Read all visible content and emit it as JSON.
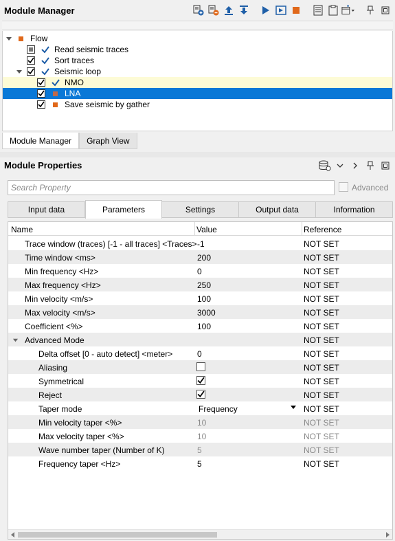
{
  "module_manager": {
    "title": "Module Manager",
    "tree": [
      {
        "label": "Flow",
        "level": 0,
        "expanded": true,
        "marker": "orange-square"
      },
      {
        "label": "Read seismic traces",
        "level": 1,
        "checked": "partial",
        "status": "check"
      },
      {
        "label": "Sort traces",
        "level": 1,
        "checked": true,
        "status": "check"
      },
      {
        "label": "Seismic loop",
        "level": 1,
        "checked": true,
        "status": "check",
        "expanded": true
      },
      {
        "label": "NMO",
        "level": 2,
        "checked": true,
        "status": "check",
        "highlight": true
      },
      {
        "label": "LNA",
        "level": 2,
        "checked": true,
        "status": "orange-square",
        "selected": true
      },
      {
        "label": "Save seismic by gather",
        "level": 2,
        "checked": true,
        "status": "orange-square"
      }
    ],
    "tabs": [
      "Module Manager",
      "Graph View"
    ],
    "active_tab": "Module Manager"
  },
  "module_properties": {
    "title": "Module Properties",
    "search_placeholder": "Search Property",
    "advanced_label": "Advanced",
    "tabs": [
      "Input data",
      "Parameters",
      "Settings",
      "Output data",
      "Information"
    ],
    "active_tab": "Parameters",
    "columns": [
      "Name",
      "Value",
      "Reference"
    ],
    "rows": [
      {
        "name": "Trace window (traces) [-1 - all traces] <Traces>",
        "value": "-1",
        "ref": "NOT SET"
      },
      {
        "name": "Time window <ms>",
        "value": "200",
        "ref": "NOT SET"
      },
      {
        "name": "Min frequency <Hz>",
        "value": "0",
        "ref": "NOT SET"
      },
      {
        "name": "Max frequency <Hz>",
        "value": "250",
        "ref": "NOT SET"
      },
      {
        "name": "Min velocity <m/s>",
        "value": "100",
        "ref": "NOT SET"
      },
      {
        "name": "Max velocity <m/s>",
        "value": "3000",
        "ref": "NOT SET"
      },
      {
        "name": "Coefficient <%>",
        "value": "100",
        "ref": "NOT SET"
      },
      {
        "name": "Advanced Mode",
        "value": "",
        "ref": "NOT SET",
        "group": true
      },
      {
        "name": "Delta offset [0 - auto detect] <meter>",
        "value": "0",
        "ref": "NOT SET",
        "indent": true
      },
      {
        "name": "Aliasing",
        "value": "",
        "ref": "NOT SET",
        "indent": true,
        "checkbox": false
      },
      {
        "name": "Symmetrical",
        "value": "",
        "ref": "NOT SET",
        "indent": true,
        "checkbox": true
      },
      {
        "name": "Reject",
        "value": "",
        "ref": "NOT SET",
        "indent": true,
        "checkbox": true
      },
      {
        "name": "Taper mode",
        "value": "Frequency",
        "ref": "NOT SET",
        "indent": true,
        "dropdown": true
      },
      {
        "name": "Min velocity taper <%>",
        "value": "10",
        "ref": "NOT SET",
        "indent": true,
        "disabled": true
      },
      {
        "name": "Max velocity taper <%>",
        "value": "10",
        "ref": "NOT SET",
        "indent": true,
        "disabled": true
      },
      {
        "name": "Wave number taper (Number of K)",
        "value": "5",
        "ref": "NOT SET",
        "indent": true,
        "disabled": true
      },
      {
        "name": "Frequency taper <Hz>",
        "value": "5",
        "ref": "NOT SET",
        "indent": true
      }
    ]
  },
  "colors": {
    "accent": "#0a78d7",
    "orange": "#e0681a",
    "highlight": "#fdfbd6",
    "check_blue": "#1f5fa8"
  }
}
